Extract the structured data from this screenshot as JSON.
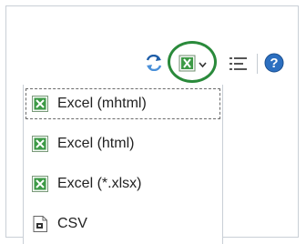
{
  "toolbar": {
    "buttons": [
      {
        "name": "refresh",
        "icon": "refresh-icon"
      },
      {
        "name": "export",
        "icon": "excel-icon",
        "has_dropdown": true,
        "highlighted": true
      },
      {
        "name": "columns",
        "icon": "list-settings-icon"
      },
      {
        "name": "help",
        "icon": "help-icon",
        "glyph": "?"
      }
    ]
  },
  "export_menu": {
    "items": [
      {
        "label": "Excel (mhtml)",
        "icon": "excel-file-icon",
        "focused": true
      },
      {
        "label": "Excel (html)",
        "icon": "excel-file-icon"
      },
      {
        "label": "Excel (*.xlsx)",
        "icon": "excel-file-icon"
      },
      {
        "label": "CSV",
        "icon": "csv-file-icon"
      }
    ]
  },
  "colors": {
    "highlight_ring": "#2a8a3b",
    "excel_green": "#3d9a46",
    "help_blue": "#2c6fc0",
    "border": "#c9cfd6"
  }
}
